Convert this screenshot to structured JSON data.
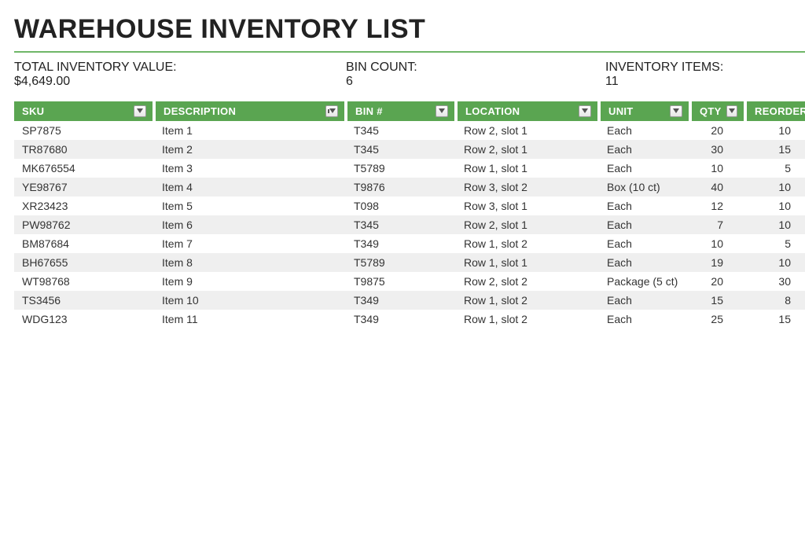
{
  "title": "WAREHOUSE INVENTORY LIST",
  "summary": {
    "total_label": "TOTAL INVENTORY VALUE:",
    "total_value": "$4,649.00",
    "bin_label": "BIN COUNT:",
    "bin_value": "6",
    "items_label": "INVENTORY ITEMS:",
    "items_value": "11"
  },
  "headers": {
    "sku": "SKU",
    "description": "DESCRIPTION",
    "bin": "BIN #",
    "location": "LOCATION",
    "unit": "UNIT",
    "qty": "QTY",
    "reorder": "REORDER"
  },
  "rows": [
    {
      "sku": "SP7875",
      "desc": "Item 1",
      "bin": "T345",
      "loc": "Row 2, slot 1",
      "unit": "Each",
      "qty": "20",
      "re": "10"
    },
    {
      "sku": "TR87680",
      "desc": "Item 2",
      "bin": "T345",
      "loc": "Row 2, slot 1",
      "unit": "Each",
      "qty": "30",
      "re": "15"
    },
    {
      "sku": "MK676554",
      "desc": "Item 3",
      "bin": "T5789",
      "loc": "Row 1, slot 1",
      "unit": "Each",
      "qty": "10",
      "re": "5"
    },
    {
      "sku": "YE98767",
      "desc": "Item 4",
      "bin": "T9876",
      "loc": "Row 3, slot 2",
      "unit": "Box (10 ct)",
      "qty": "40",
      "re": "10"
    },
    {
      "sku": "XR23423",
      "desc": "Item 5",
      "bin": "T098",
      "loc": "Row 3, slot 1",
      "unit": "Each",
      "qty": "12",
      "re": "10"
    },
    {
      "sku": "PW98762",
      "desc": "Item 6",
      "bin": "T345",
      "loc": "Row 2, slot 1",
      "unit": "Each",
      "qty": "7",
      "re": "10"
    },
    {
      "sku": "BM87684",
      "desc": "Item 7",
      "bin": "T349",
      "loc": "Row 1, slot 2",
      "unit": "Each",
      "qty": "10",
      "re": "5"
    },
    {
      "sku": "BH67655",
      "desc": "Item 8",
      "bin": "T5789",
      "loc": "Row 1, slot 1",
      "unit": "Each",
      "qty": "19",
      "re": "10"
    },
    {
      "sku": "WT98768",
      "desc": "Item 9",
      "bin": "T9875",
      "loc": "Row 2, slot 2",
      "unit": "Package (5 ct)",
      "qty": "20",
      "re": "30"
    },
    {
      "sku": "TS3456",
      "desc": "Item 10",
      "bin": "T349",
      "loc": "Row 1, slot 2",
      "unit": "Each",
      "qty": "15",
      "re": "8"
    },
    {
      "sku": "WDG123",
      "desc": "Item 11",
      "bin": "T349",
      "loc": "Row 1, slot 2",
      "unit": "Each",
      "qty": "25",
      "re": "15"
    }
  ]
}
